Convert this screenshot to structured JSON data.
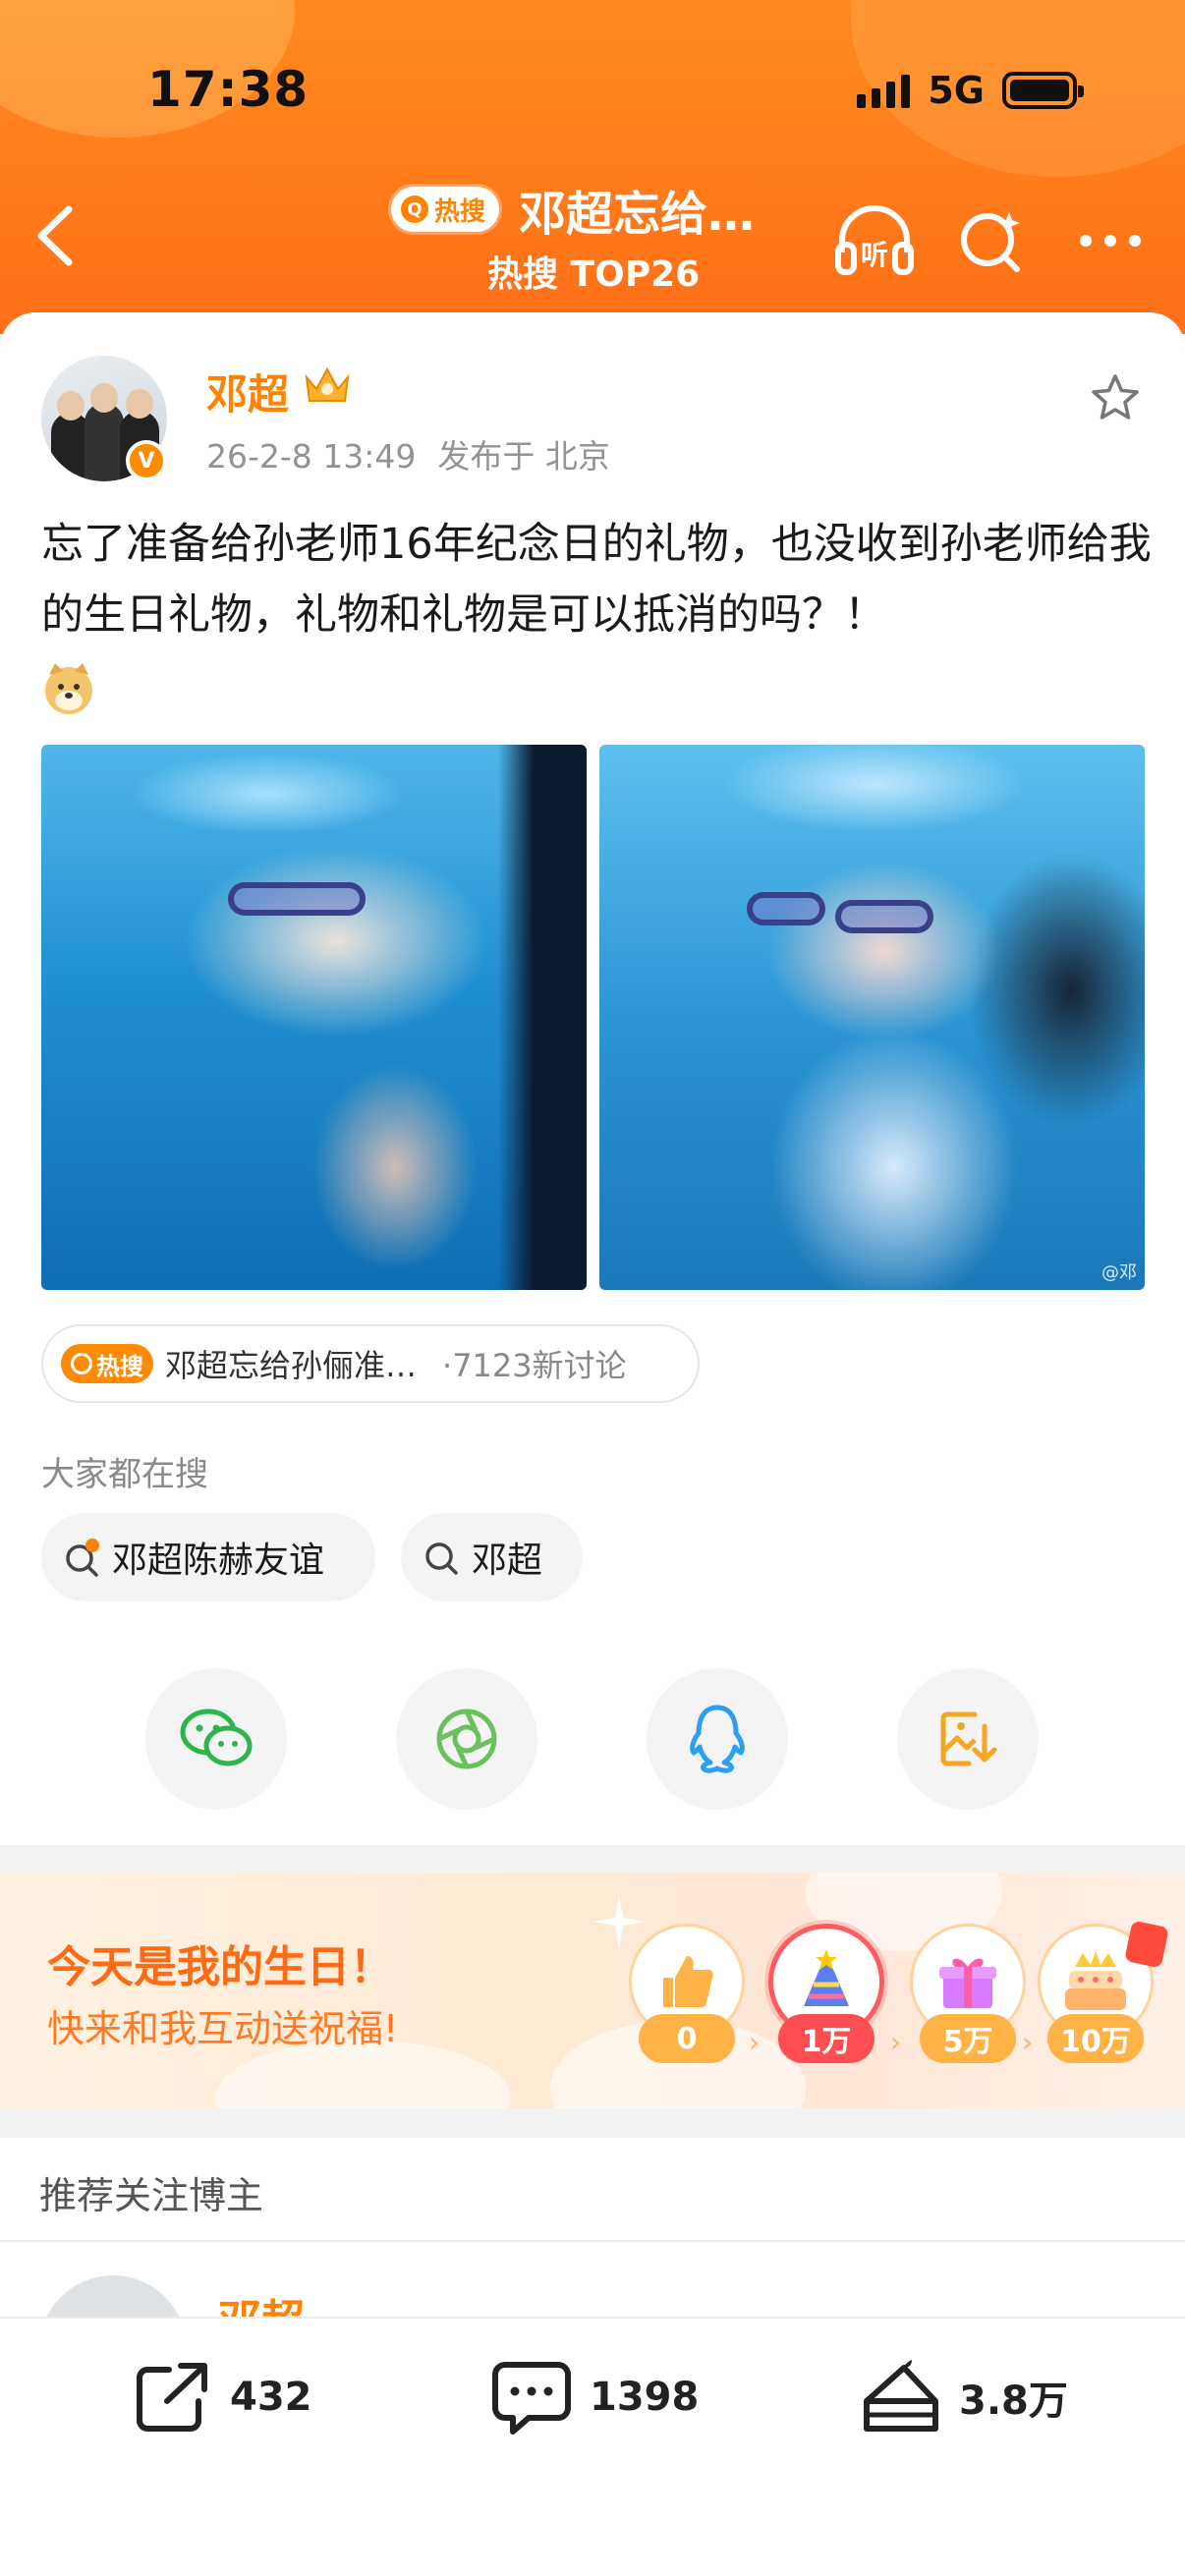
{
  "status_bar": {
    "time": "17:38",
    "network": "5G"
  },
  "header": {
    "hot_tag": "热搜",
    "title": "邓超忘给…",
    "subtitle": "热搜 TOP26",
    "listen_label": "听"
  },
  "post": {
    "author": "邓超",
    "date": "26-2-8 13:49",
    "location": "发布于 北京",
    "text": "忘了准备给孙老师16年纪念日的礼物，也没收到孙老师给我的生日礼物，礼物和礼物是可以抵消的吗？！",
    "watermark": "@邓"
  },
  "topic": {
    "badge": "热搜",
    "title": "邓超忘给孙俪准…",
    "count": "·7123新讨论"
  },
  "search": {
    "label": "大家都在搜",
    "chips": [
      "邓超陈赫友谊",
      "邓超"
    ]
  },
  "share_icons": [
    "wechat-icon",
    "moments-icon",
    "qq-icon",
    "save-image-icon"
  ],
  "birthday": {
    "title": "今天是我的生日！",
    "subtitle": "快来和我互动送祝福!",
    "milestones": [
      "0",
      "1万",
      "5万",
      "10万"
    ]
  },
  "recommend": {
    "title": "推荐关注博主",
    "name": "邓超"
  },
  "actions": {
    "repost": "432",
    "comment": "1398",
    "like": "3.8万"
  },
  "colors": {
    "accent": "#ff8200",
    "header": "#ff7a1a"
  }
}
